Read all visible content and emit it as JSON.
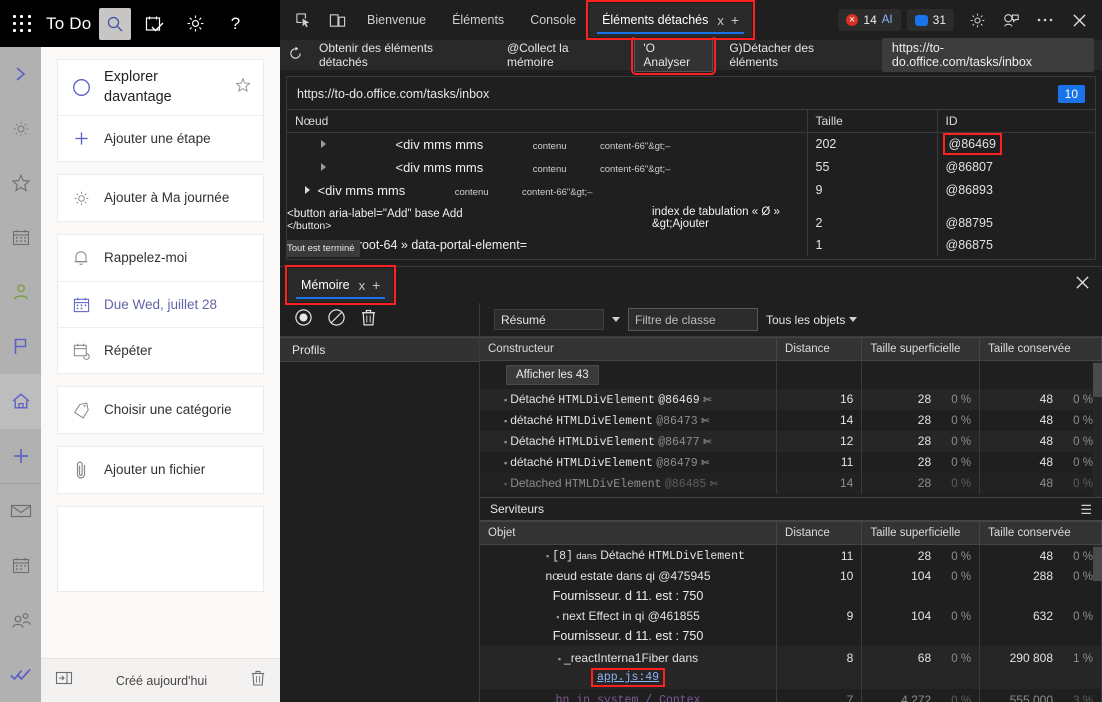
{
  "todo": {
    "brand": "To Do",
    "topbar_buttons": [
      {
        "name": "waffle",
        "label": "App launcher"
      },
      {
        "name": "search",
        "label": "Rechercher"
      },
      {
        "name": "tasks",
        "label": "Tâches"
      },
      {
        "name": "settings",
        "label": "Paramètres"
      },
      {
        "name": "help",
        "label": "?"
      }
    ],
    "help_label": "?",
    "rail": [
      {
        "icon": "chevron-right-icon",
        "name": "expand"
      },
      {
        "icon": "sun-icon",
        "name": "my-day"
      },
      {
        "icon": "star-icon",
        "name": "important"
      },
      {
        "icon": "calendar-icon",
        "name": "planned"
      },
      {
        "icon": "person-icon",
        "name": "assigned-to-me"
      },
      {
        "icon": "flag-icon",
        "name": "flagged-email"
      },
      {
        "icon": "home-icon",
        "name": "tasks"
      },
      {
        "icon": "plus-icon",
        "name": "new-list"
      },
      {
        "icon": "mail-icon",
        "name": "mail"
      },
      {
        "icon": "calendar-icon",
        "name": "calendar"
      },
      {
        "icon": "people-icon",
        "name": "people"
      },
      {
        "icon": "todo-check-icon",
        "name": "to-do"
      }
    ],
    "task": {
      "title": "Explorer davantage",
      "add_step": "Ajouter une étape",
      "add_to_my_day": "Ajouter à Ma journée",
      "remind_me": "Rappelez-moi",
      "due_date": "Due Wed, juillet 28",
      "repeat": "Répéter",
      "pick_category": "Choisir une catégorie",
      "add_file": "Ajouter un fichier",
      "note_placeholder": ""
    },
    "footer": {
      "created": "Créé aujourd'hui",
      "collapse_icon": "collapse-pane-icon",
      "delete_icon": "trash-icon"
    }
  },
  "devtools": {
    "tabs": [
      {
        "label": "Bienvenue",
        "active": false
      },
      {
        "label": "Éléments",
        "active": false
      },
      {
        "label": "Console",
        "active": false
      },
      {
        "label": "Éléments détachés",
        "active": true,
        "close": "x",
        "plus": "+",
        "highlighted": true
      }
    ],
    "left_icons": [
      {
        "name": "inspect-element-icon"
      },
      {
        "name": "device-toolbar-icon"
      }
    ],
    "right": {
      "errors_badge": {
        "count": "14",
        "ai": "AI"
      },
      "messages_badge": {
        "count": "31"
      },
      "settings_icon": "gear-icon",
      "issues_icon": "issues-icon",
      "more_icon": "more-menu-icon",
      "close_icon": "close-icon"
    },
    "actions": {
      "refresh_icon": "refresh-icon",
      "get_detached": "Obtenir des éléments détachés",
      "collect_memory": "@Collect la mémoire",
      "analyse": "'O Analyser",
      "detach_elements": "G)Détacher des éléments",
      "url": "https://to-do.office.com/tasks/inbox"
    },
    "detached_panel": {
      "url": "https://to-do.office.com/tasks/inbox",
      "count_badge": "10",
      "columns": [
        "Nœud",
        "Taille",
        "ID"
      ],
      "rows": [
        {
          "indent": 2,
          "tag": "<div mms mms",
          "attr": "contenu",
          "value": "content-66\"&gt;–",
          "size": "202",
          "id": "@86469",
          "id_highlight": true
        },
        {
          "indent": 2,
          "tag": "<div mms mms",
          "attr": "contenu",
          "value": "content-66\"&gt;–",
          "size": "55",
          "id": "@86807",
          "id_highlight": false
        },
        {
          "indent": 1,
          "tag": "<div mms mms",
          "attr": "contenu",
          "value": "content-66\"&gt;–",
          "size": "9",
          "id": "@86893",
          "id_highlight": false
        },
        {
          "indent": 0,
          "tag": "<button aria-label=\"Add\" base Add",
          "tag2": "</button>",
          "attr": "",
          "value": "index de tabulation « Ø » &gt;Ajouter",
          "size": "2",
          "id": "@88795",
          "id_highlight": false
        },
        {
          "indent": 0,
          "tag": "v mms mms root-64 » data-portal-element=",
          "attr": "",
          "value": "",
          "size": "1",
          "id": "@86875",
          "id_highlight": false
        }
      ],
      "tooltip": "Tout est terminé"
    },
    "memory": {
      "tab_label": "Mémoire",
      "tab_close": "x",
      "tab_plus": "+",
      "close_icon": "close-icon",
      "toolbar": {
        "record_icon": "record-icon",
        "clear_icon": "no-entry-icon",
        "delete_icon": "trash-icon",
        "view_select": "Résumé",
        "class_filter_placeholder": "Filtre de classe",
        "objects_select": "Tous les objets"
      },
      "profiles_header": "Profils",
      "constructors": {
        "columns": [
          "Constructeur",
          "Distance",
          "Taille superficielle",
          "Taille conservée"
        ],
        "show_all": "Afficher les 43",
        "rows": [
          {
            "label": "Détaché",
            "ctor": "HTMLDivElement",
            "id": "@86469",
            "id_faded": false,
            "distance": "16",
            "shallow": "28",
            "shallow_pct": "0 %",
            "retained": "48",
            "retained_pct": "0 %"
          },
          {
            "label": "détaché",
            "ctor": "HTMLDivElement",
            "id": "@86473",
            "id_faded": true,
            "distance": "14",
            "shallow": "28",
            "shallow_pct": "0 %",
            "retained": "48",
            "retained_pct": "0 %"
          },
          {
            "label": "Détaché",
            "ctor": "HTMLDivElement",
            "id": "@86477",
            "id_faded": true,
            "distance": "12",
            "shallow": "28",
            "shallow_pct": "0 %",
            "retained": "48",
            "retained_pct": "0 %"
          },
          {
            "label": "détaché",
            "ctor": "HTMLDivElement",
            "id": "@86479",
            "id_faded": true,
            "distance": "11",
            "shallow": "28",
            "shallow_pct": "0 %",
            "retained": "48",
            "retained_pct": "0 %"
          },
          {
            "label": "Detached",
            "ctor": "HTMLDivElement",
            "id": "@86485",
            "id_faded": true,
            "distance": "14",
            "shallow": "28",
            "shallow_pct": "0 %",
            "retained": "48",
            "retained_pct": "0 %"
          }
        ]
      },
      "retainers": {
        "title": "Serviteurs",
        "menu_icon": "hamburger-icon",
        "columns": [
          "Objet",
          "Distance",
          "Taille superficielle",
          "Taille conservée"
        ],
        "rows": [
          {
            "index": "[8]",
            "in": "dans",
            "label": "Détaché",
            "ctor": "HTMLDivElement",
            "distance": "11",
            "shallow": "28",
            "shallow_pct": "0 %",
            "retained": "48",
            "retained_pct": "0 %"
          },
          {
            "label": "nœud estate dans qi @475945",
            "distance": "10",
            "shallow": "104",
            "shallow_pct": "0 %",
            "retained": "288",
            "retained_pct": "0 %"
          },
          {
            "provider": "Fournisseur. d 11. est : 750"
          },
          {
            "label": "next Effect in qi @461855",
            "distance": "9",
            "shallow": "104",
            "shallow_pct": "0 %",
            "retained": "632",
            "retained_pct": "0 %"
          },
          {
            "provider": "Fournisseur. d 11. est : 750"
          },
          {
            "label": "_reactInterna1Fiber dans",
            "link": "app.js:49",
            "link_highlight": true,
            "distance": "8",
            "shallow": "68",
            "shallow_pct": "0 %",
            "retained": "290 808",
            "retained_pct": "1 %"
          },
          {
            "label": "bn in system / Contex",
            "distance": "7",
            "shallow": "4 272",
            "shallow_pct": "0 %",
            "retained": "555 000",
            "retained_pct": "3 %"
          }
        ]
      }
    }
  },
  "colors": {
    "accent_blue": "#1a73e8",
    "highlight_red": "#ff2020",
    "todo_purple": "#6264a7",
    "error_red": "#d93025",
    "link_blue": "#8ab4f8"
  }
}
